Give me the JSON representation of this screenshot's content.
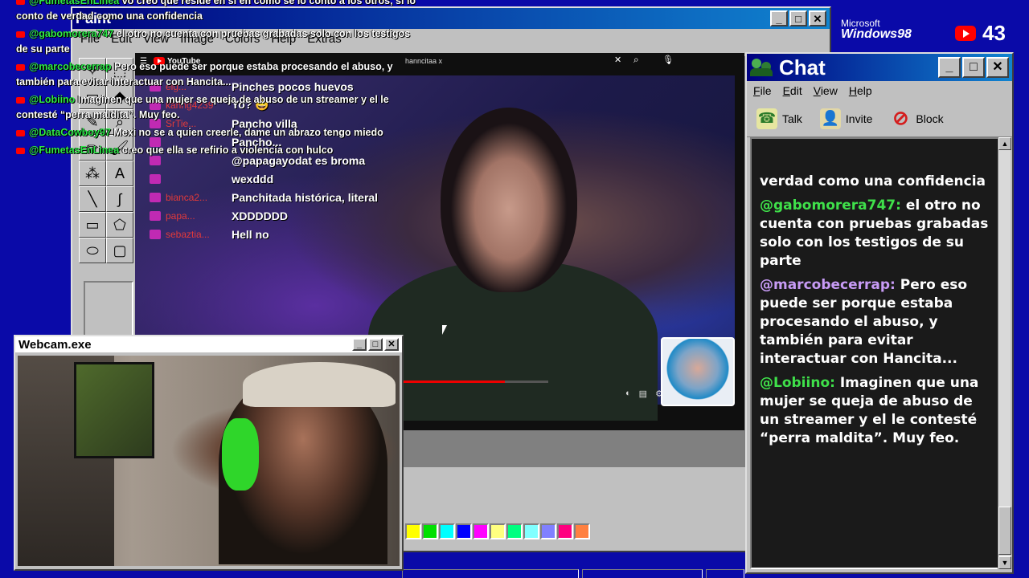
{
  "paint": {
    "title": "Paint",
    "menu": [
      "File",
      "Edit",
      "View",
      "Image",
      "Colors",
      "Help",
      "Extras"
    ],
    "palette": [
      "#ffff00",
      "#00e000",
      "#00ffff",
      "#0000ff",
      "#ff00ff",
      "#ffff80",
      "#00ff80",
      "#80ffff",
      "#8080ff",
      "#ff0080",
      "#ff8040"
    ]
  },
  "youtube": {
    "logo": "YouTube",
    "search_value": "hanncitaa x",
    "chat": [
      {
        "user": "elg...",
        "msg": "Pinches pocos huevos"
      },
      {
        "user": "kanng4239",
        "msg": "Yo? 😀"
      },
      {
        "user": "SrTie...",
        "msg": "Pancho villa"
      },
      {
        "user": "",
        "msg": "Pancho..."
      },
      {
        "user": "",
        "msg": "@papagayodat es broma"
      },
      {
        "user": "",
        "msg": "wexddd"
      },
      {
        "user": "bianca2...",
        "msg": "Panchitada histórica, literal"
      },
      {
        "user": "papa...",
        "msg": "XDDDDDD"
      },
      {
        "user": "sebaztia...",
        "msg": "Hell no"
      }
    ]
  },
  "overlay_chat": [
    {
      "user": "@FumetasEnLinea",
      "text": " vo creo que reside en si en como se lo conto a los otros, si lo conto de verdad como una confidencia"
    },
    {
      "user": "@gabomorera747",
      "text": " el otro no cuenta con pruebas grabadas solo con los testigos de su parte"
    },
    {
      "user": "@marcobecerrap",
      "text": " Pero eso puede ser porque estaba procesando el abuso, y también para evitar interactuar con Hancita..."
    },
    {
      "user": "@Lobiino",
      "text": " Imaginen que una mujer se queja de abuso de un streamer y el le contesté “perra maldita”. Muy feo."
    },
    {
      "user": "@DataCowboy97",
      "text": " Mexi no se a quien creerle, dame un abrazo tengo miedo"
    },
    {
      "user": "@FumetasEnLinea",
      "text": " creo que ella se refirio a violencia con hulco"
    }
  ],
  "webcam": {
    "title": "Webcam.exe"
  },
  "chat_window": {
    "title": "Chat",
    "menu": [
      "File",
      "Edit",
      "View",
      "Help"
    ],
    "toolbar": [
      {
        "label": "Talk",
        "icon": "talk-icon"
      },
      {
        "label": "Invite",
        "icon": "invite-icon"
      },
      {
        "label": "Block",
        "icon": "block-icon"
      }
    ],
    "messages": [
      {
        "user": "",
        "text": "verdad como una confidencia"
      },
      {
        "user": "@gabomorera747:",
        "text": " el otro no cuenta con pruebas grabadas solo con los testigos de su parte"
      },
      {
        "user": "@marcobecerrap:",
        "text": " Pero eso puede ser porque estaba procesando el abuso, y también para evitar interactuar con Hancita..."
      },
      {
        "user": "@Lobiino:",
        "text": " Imaginen que una mujer se queja de abuso de un streamer y el le contesté “perra maldita”. Muy feo."
      }
    ]
  },
  "branding": {
    "ms": "Microsoft",
    "win": "Windows98",
    "viewer_count": "43"
  }
}
